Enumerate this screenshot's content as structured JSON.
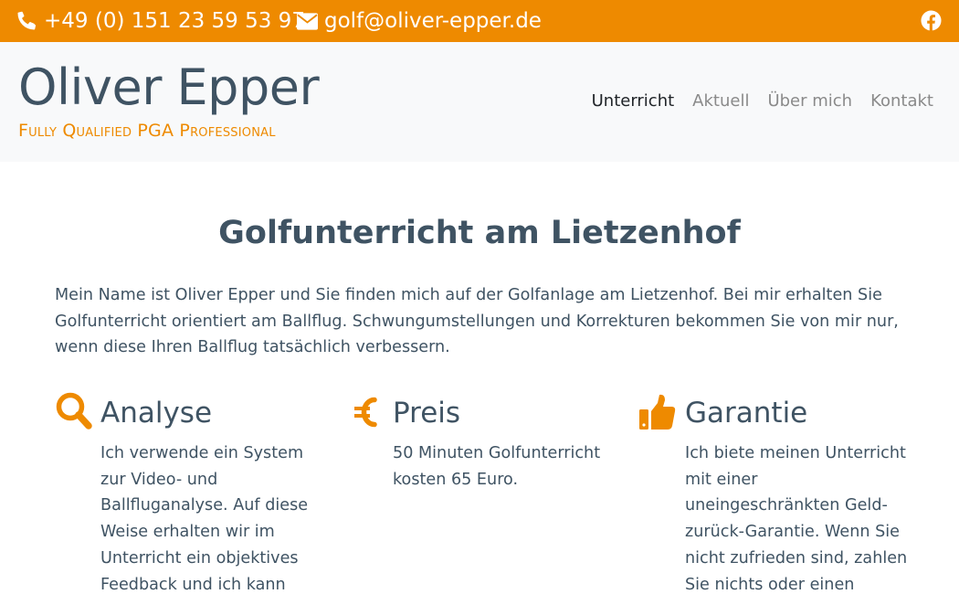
{
  "topbar": {
    "phone": "+49 (0) 151 23 59 53 97",
    "email": "golf@oliver-epper.de",
    "phone_icon": "phone-icon",
    "email_icon": "envelope-icon",
    "social_icon": "facebook-icon",
    "background_color": "#ee8a00"
  },
  "header": {
    "brand": "Oliver Epper",
    "tagline": "Fully Qualified PGA Professional",
    "nav": [
      {
        "label": "Unterricht",
        "active": true
      },
      {
        "label": "Aktuell",
        "active": false
      },
      {
        "label": "Über mich",
        "active": false
      },
      {
        "label": "Kontakt",
        "active": false
      }
    ]
  },
  "main": {
    "title": "Golfunterricht am Lietzenhof",
    "intro": "Mein Name ist Oliver Epper und Sie finden mich auf der Golfanlage am Lietzenhof. Bei mir erhalten Sie Golfunterricht orientiert am Ballflug. Schwungumstellungen und Korrekturen bekommen Sie von mir nur, wenn diese Ihren Ballflug tatsächlich verbessern.",
    "features": [
      {
        "icon": "search-icon",
        "title": "Analyse",
        "text": "Ich verwende ein System zur Video- und Ballfluganalyse. Auf diese Weise erhalten wir im Unterricht ein objektives Feedback und ich kann"
      },
      {
        "icon": "euro-icon",
        "title": "Preis",
        "text": "50 Minuten Golfunterricht kosten 65 Euro."
      },
      {
        "icon": "thumbs-up-icon",
        "title": "Garantie",
        "text": "Ich biete meinen Unterricht mit einer uneingeschränkten Geld-zurück-Garantie. Wenn Sie nicht zufrieden sind, zahlen Sie nichts oder einen"
      }
    ]
  },
  "colors": {
    "accent": "#ee8a00",
    "text": "#3f5363",
    "header_bg": "#f8f9fa",
    "nav_muted": "#8a8a8a",
    "nav_active": "#212529"
  }
}
